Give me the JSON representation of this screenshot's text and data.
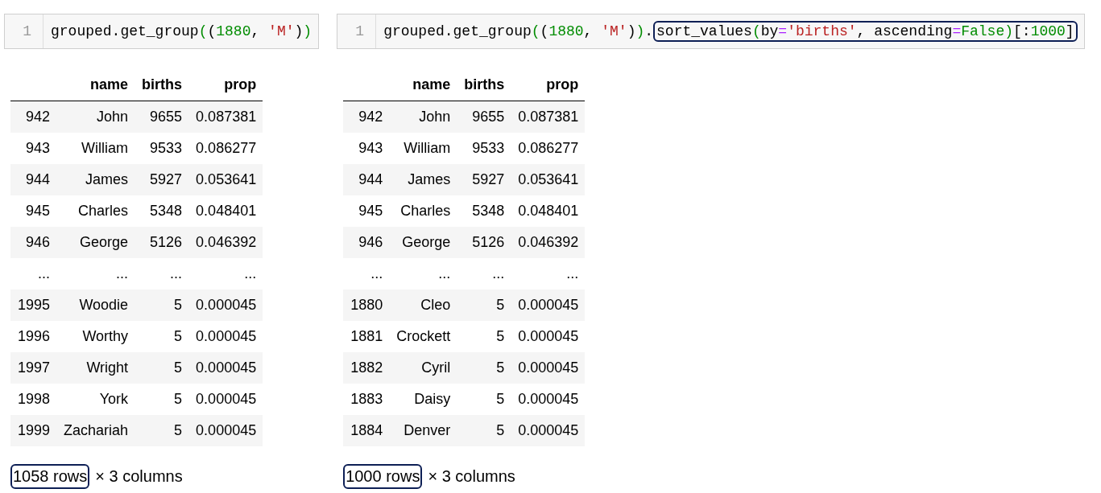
{
  "cells": [
    {
      "line_number": "1",
      "segments": [
        {
          "highlighted": false,
          "tokens": [
            {
              "text": "grouped.get_group",
              "kind": "plain"
            },
            {
              "text": "(",
              "kind": "number"
            },
            {
              "text": "(",
              "kind": "plain"
            },
            {
              "text": "1880",
              "kind": "number"
            },
            {
              "text": ", ",
              "kind": "plain"
            },
            {
              "text": "'M'",
              "kind": "string"
            },
            {
              "text": ")",
              "kind": "plain"
            },
            {
              "text": ")",
              "kind": "number"
            }
          ]
        }
      ],
      "output": {
        "columns": [
          "",
          "name",
          "births",
          "prop"
        ],
        "rows": [
          [
            "942",
            "John",
            "9655",
            "0.087381"
          ],
          [
            "943",
            "William",
            "9533",
            "0.086277"
          ],
          [
            "944",
            "James",
            "5927",
            "0.053641"
          ],
          [
            "945",
            "Charles",
            "5348",
            "0.048401"
          ],
          [
            "946",
            "George",
            "5126",
            "0.046392"
          ],
          [
            "...",
            "...",
            "...",
            "..."
          ],
          [
            "1995",
            "Woodie",
            "5",
            "0.000045"
          ],
          [
            "1996",
            "Worthy",
            "5",
            "0.000045"
          ],
          [
            "1997",
            "Wright",
            "5",
            "0.000045"
          ],
          [
            "1998",
            "York",
            "5",
            "0.000045"
          ],
          [
            "1999",
            "Zachariah",
            "5",
            "0.000045"
          ]
        ],
        "footer": [
          {
            "text": "1058 rows",
            "highlighted": true
          },
          {
            "text": "× 3 columns",
            "highlighted": false
          }
        ]
      }
    },
    {
      "line_number": "1",
      "segments": [
        {
          "highlighted": false,
          "tokens": [
            {
              "text": "grouped.get_group",
              "kind": "plain"
            },
            {
              "text": "(",
              "kind": "number"
            },
            {
              "text": "(",
              "kind": "plain"
            },
            {
              "text": "1880",
              "kind": "number"
            },
            {
              "text": ", ",
              "kind": "plain"
            },
            {
              "text": "'M'",
              "kind": "string"
            },
            {
              "text": ")",
              "kind": "plain"
            },
            {
              "text": ")",
              "kind": "number"
            },
            {
              "text": ".",
              "kind": "plain"
            }
          ]
        },
        {
          "highlighted": true,
          "tokens": [
            {
              "text": "sort_values",
              "kind": "plain"
            },
            {
              "text": "(",
              "kind": "number"
            },
            {
              "text": "by",
              "kind": "plain"
            },
            {
              "text": "=",
              "kind": "operator"
            },
            {
              "text": "'births'",
              "kind": "string"
            },
            {
              "text": ", ascending",
              "kind": "plain"
            },
            {
              "text": "=",
              "kind": "operator"
            },
            {
              "text": "False",
              "kind": "number"
            },
            {
              "text": ")",
              "kind": "number"
            },
            {
              "text": "[:",
              "kind": "plain"
            },
            {
              "text": "1000",
              "kind": "number"
            },
            {
              "text": "]",
              "kind": "plain"
            }
          ]
        }
      ],
      "output": {
        "columns": [
          "",
          "name",
          "births",
          "prop"
        ],
        "rows": [
          [
            "942",
            "John",
            "9655",
            "0.087381"
          ],
          [
            "943",
            "William",
            "9533",
            "0.086277"
          ],
          [
            "944",
            "James",
            "5927",
            "0.053641"
          ],
          [
            "945",
            "Charles",
            "5348",
            "0.048401"
          ],
          [
            "946",
            "George",
            "5126",
            "0.046392"
          ],
          [
            "...",
            "...",
            "...",
            "..."
          ],
          [
            "1880",
            "Cleo",
            "5",
            "0.000045"
          ],
          [
            "1881",
            "Crockett",
            "5",
            "0.000045"
          ],
          [
            "1882",
            "Cyril",
            "5",
            "0.000045"
          ],
          [
            "1883",
            "Daisy",
            "5",
            "0.000045"
          ],
          [
            "1884",
            "Denver",
            "5",
            "0.000045"
          ]
        ],
        "footer": [
          {
            "text": "1000 rows",
            "highlighted": true
          },
          {
            "text": "× 3 columns",
            "highlighted": false
          }
        ]
      }
    }
  ]
}
